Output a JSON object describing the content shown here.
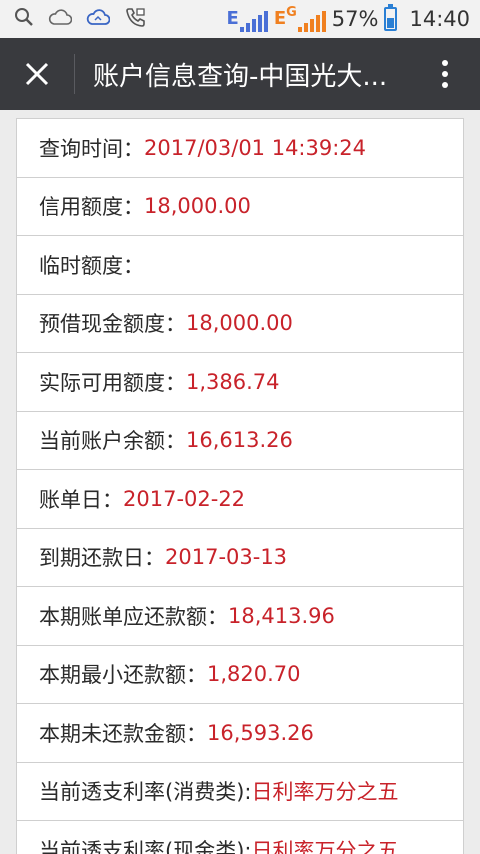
{
  "status_bar": {
    "network_1": "E",
    "network_2": "E",
    "network_2b": "G",
    "battery_percent": "57%",
    "battery_level": 0.57,
    "time": "14:40",
    "icons": [
      "search-icon",
      "cloud-icon",
      "cloud-sync-icon",
      "phone-icon"
    ]
  },
  "app_bar": {
    "title": "账户信息查询-中国光大..."
  },
  "rows": [
    {
      "label": "查询时间：",
      "value": "2017/03/01 14:39:24"
    },
    {
      "label": "信用额度：",
      "value": "18,000.00"
    },
    {
      "label": "临时额度：",
      "value": ""
    },
    {
      "label": "预借现金额度：",
      "value": "18,000.00"
    },
    {
      "label": "实际可用额度：",
      "value": "1,386.74"
    },
    {
      "label": "当前账户余额：",
      "value": "16,613.26"
    },
    {
      "label": "账单日：",
      "value": "2017-02-22"
    },
    {
      "label": "到期还款日：",
      "value": "2017-03-13"
    },
    {
      "label": "本期账单应还款额：",
      "value": "18,413.96"
    },
    {
      "label": "本期最小还款额：",
      "value": "1,820.70"
    },
    {
      "label": "本期未还款金额：",
      "value": "16,593.26"
    },
    {
      "label": "当前透支利率(消费类):",
      "value": "日利率万分之五"
    },
    {
      "label": "当前透支利率(现金类):",
      "value": "日利率万分之五"
    }
  ],
  "colors": {
    "app_bar_bg": "#393a3e",
    "value_red": "#c8222a",
    "network_blue": "#4a6fd6",
    "network_orange": "#f08020",
    "battery_blue": "#2a7fd4"
  }
}
